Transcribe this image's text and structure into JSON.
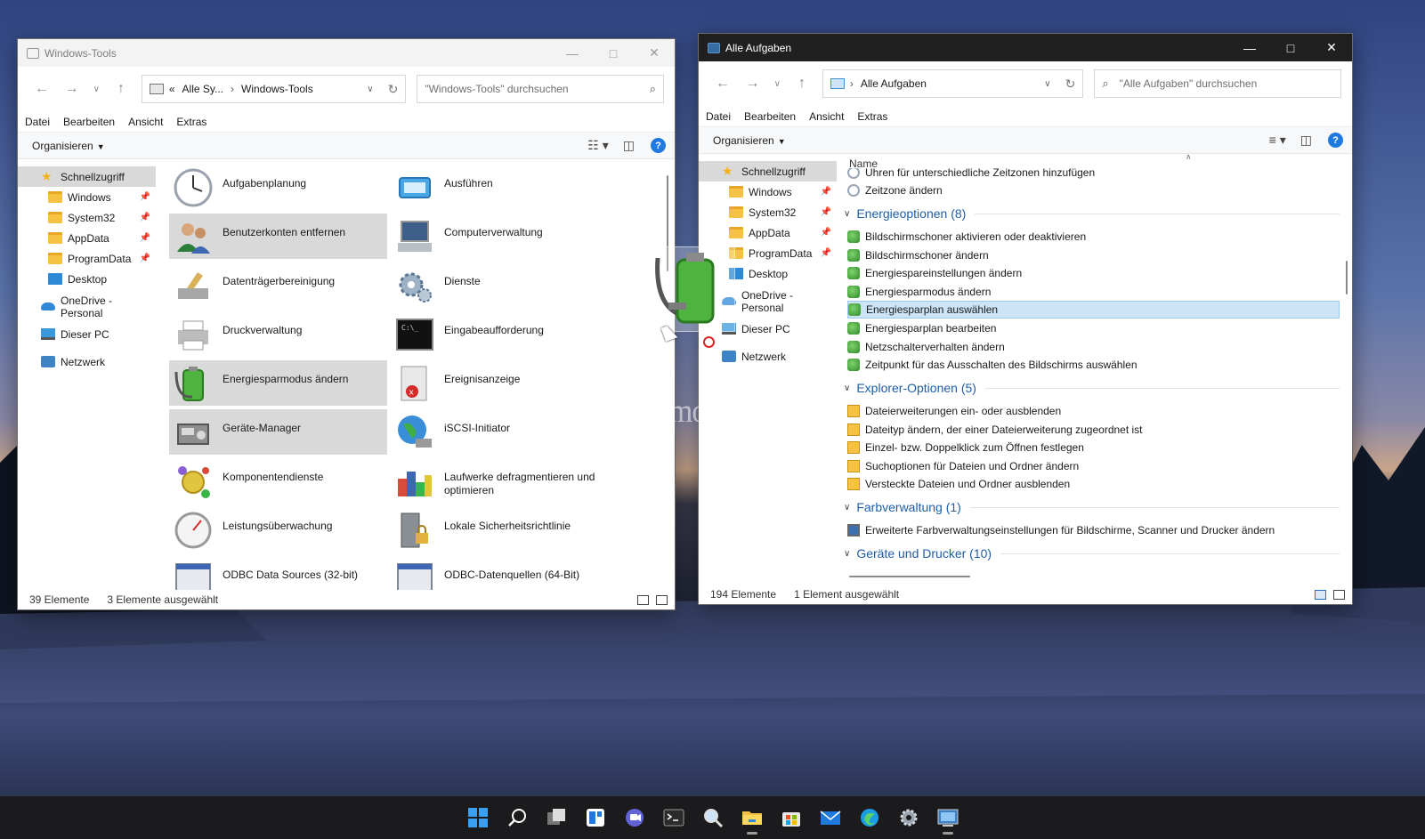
{
  "left_window": {
    "title": "Windows-Tools",
    "address": {
      "crumbs": [
        "«",
        "Alle Sy...",
        "›",
        "Windows-Tools"
      ]
    },
    "search_placeholder": "\"Windows-Tools\" durchsuchen",
    "menu": [
      "Datei",
      "Bearbeiten",
      "Ansicht",
      "Extras"
    ],
    "organize": "Organisieren",
    "nav": [
      {
        "label": "Schnellzugriff",
        "icon": "star-icon"
      },
      {
        "label": "Windows",
        "icon": "folder-icon",
        "pinned": true
      },
      {
        "label": "System32",
        "icon": "folder-icon",
        "pinned": true
      },
      {
        "label": "AppData",
        "icon": "folder-icon",
        "pinned": true
      },
      {
        "label": "ProgramData",
        "icon": "folder-icon",
        "pinned": true
      },
      {
        "label": "Desktop",
        "icon": "desktop-icon"
      },
      {
        "label": "OneDrive - Personal",
        "icon": "onedrive-icon"
      },
      {
        "label": "Dieser PC",
        "icon": "pc-icon"
      },
      {
        "label": "Netzwerk",
        "icon": "network-icon"
      }
    ],
    "items": [
      {
        "label": "Aufgabenplanung",
        "icon": "clock-icon",
        "selected": false
      },
      {
        "label": "Ausführen",
        "icon": "run-icon",
        "selected": false
      },
      {
        "label": "Benutzerkonten entfernen",
        "icon": "users-icon",
        "selected": true
      },
      {
        "label": "Computerverwaltung",
        "icon": "computer-management-icon",
        "selected": false
      },
      {
        "label": "Datenträgerbereinigung",
        "icon": "disk-cleanup-icon",
        "selected": false
      },
      {
        "label": "Dienste",
        "icon": "gears-icon",
        "selected": false
      },
      {
        "label": "Druckverwaltung",
        "icon": "printer-icon",
        "selected": false
      },
      {
        "label": "Eingabeaufforderung",
        "icon": "cmd-icon",
        "selected": false
      },
      {
        "label": "Energiesparmodus ändern",
        "icon": "battery-icon",
        "selected": true
      },
      {
        "label": "Ereignisanzeige",
        "icon": "event-viewer-icon",
        "selected": false
      },
      {
        "label": "Geräte-Manager",
        "icon": "device-manager-icon",
        "selected": true
      },
      {
        "label": "iSCSI-Initiator",
        "icon": "globe-icon",
        "selected": false
      },
      {
        "label": "Komponentendienste",
        "icon": "components-icon",
        "selected": false
      },
      {
        "label": "Laufwerke defragmentieren und optimieren",
        "icon": "defrag-icon",
        "selected": false
      },
      {
        "label": "Leistungsüberwachung",
        "icon": "gauge-icon",
        "selected": false
      },
      {
        "label": "Lokale Sicherheitsrichtlinie",
        "icon": "security-policy-icon",
        "selected": false
      },
      {
        "label": "ODBC Data Sources (32-bit)",
        "icon": "odbc-icon",
        "selected": false
      },
      {
        "label": "ODBC-Datenquellen (64-Bit)",
        "icon": "odbc-icon",
        "selected": false
      }
    ],
    "status": {
      "count": "39 Elemente",
      "selection": "3 Elemente ausgewählt"
    }
  },
  "right_window": {
    "title": "Alle Aufgaben",
    "address": {
      "crumbs": [
        "›",
        "Alle Aufgaben"
      ]
    },
    "search_placeholder": "\"Alle Aufgaben\" durchsuchen",
    "menu": [
      "Datei",
      "Bearbeiten",
      "Ansicht",
      "Extras"
    ],
    "organize": "Organisieren",
    "nav": [
      {
        "label": "Schnellzugriff",
        "icon": "star-icon"
      },
      {
        "label": "Windows",
        "icon": "folder-icon",
        "pinned": true
      },
      {
        "label": "System32",
        "icon": "folder-icon",
        "pinned": true
      },
      {
        "label": "AppData",
        "icon": "folder-icon",
        "pinned": true
      },
      {
        "label": "ProgramData",
        "icon": "folder-icon",
        "pinned": true
      },
      {
        "label": "Desktop",
        "icon": "desktop-icon"
      },
      {
        "label": "OneDrive - Personal",
        "icon": "onedrive-icon"
      },
      {
        "label": "Dieser PC",
        "icon": "pc-icon"
      },
      {
        "label": "Netzwerk",
        "icon": "network-icon"
      }
    ],
    "column_header": "Name",
    "partial_rows": [
      "Uhren für unterschiedliche Zeitzonen hinzufügen",
      "Zeitzone ändern"
    ],
    "groups": [
      {
        "title": "Energieoptionen (8)",
        "items": [
          "Bildschirmschoner aktivieren oder deaktivieren",
          "Bildschirmschoner ändern",
          "Energiespareinstellungen ändern",
          "Energiesparmodus ändern",
          "Energiesparplan auswählen",
          "Energiesparplan bearbeiten",
          "Netzschalterverhalten ändern",
          "Zeitpunkt für das Ausschalten des Bildschirms auswählen"
        ]
      },
      {
        "title": "Explorer-Optionen (5)",
        "items": [
          "Dateierweiterungen ein- oder ausblenden",
          "Dateityp ändern, der einer Dateierweiterung zugeordnet ist",
          "Einzel- bzw. Doppelklick zum Öffnen festlegen",
          "Suchoptionen für Dateien und Ordner ändern",
          "Versteckte Dateien und Ordner ausblenden"
        ]
      },
      {
        "title": "Farbverwaltung (1)",
        "items": [
          "Erweiterte Farbverwaltungseinstellungen für Bildschirme, Scanner und Drucker ändern"
        ]
      },
      {
        "title": "Geräte und Drucker (10)",
        "items": []
      }
    ],
    "selected_item": "Energiesparplan auswählen",
    "status": {
      "count": "194 Elemente",
      "selection": "1 Element ausgewählt"
    }
  },
  "watermark": "Deskmodder.de",
  "taskbar": [
    "windows-start-icon",
    "search-icon",
    "task-view-icon",
    "widgets-icon",
    "teams-chat-icon",
    "terminal-icon",
    "magnifier-icon",
    "file-explorer-icon",
    "store-icon",
    "mail-icon",
    "edge-icon",
    "settings-icon",
    "control-panel-icon"
  ]
}
